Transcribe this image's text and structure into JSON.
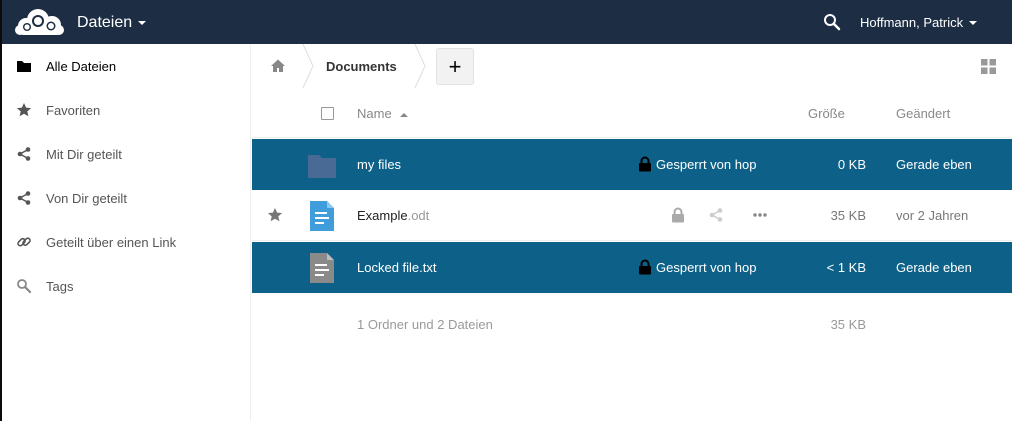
{
  "header": {
    "app_title": "Dateien",
    "user_name": "Hoffmann, Patrick",
    "colors": {
      "bar": "#1d2d44"
    }
  },
  "sidebar": {
    "items": [
      {
        "label": "Alle Dateien",
        "icon": "folder-icon",
        "active": true
      },
      {
        "label": "Favoriten",
        "icon": "star-icon",
        "active": false
      },
      {
        "label": "Mit Dir geteilt",
        "icon": "share-icon",
        "active": false
      },
      {
        "label": "Von Dir geteilt",
        "icon": "share-icon",
        "active": false
      },
      {
        "label": "Geteilt über einen Link",
        "icon": "link-icon",
        "active": false
      },
      {
        "label": "Tags",
        "icon": "tag-icon",
        "active": false
      }
    ]
  },
  "controls": {
    "breadcrumb": "Documents",
    "add_label": "+"
  },
  "table": {
    "columns": {
      "name": "Name",
      "size": "Größe",
      "modified": "Geändert"
    },
    "rows": [
      {
        "name": "my files",
        "ext": "",
        "lock_text": "Gesperrt von hop",
        "size": "0 KB",
        "modified": "Gerade eben",
        "type": "folder",
        "locked": true
      },
      {
        "name": "Example",
        "ext": ".odt",
        "lock_text": "",
        "size": "35 KB",
        "modified": "vor 2 Jahren",
        "type": "document",
        "locked": false
      },
      {
        "name": "Locked file.txt",
        "ext": "",
        "lock_text": "Gesperrt von hop",
        "size": "< 1 KB",
        "modified": "Gerade eben",
        "type": "text",
        "locked": true
      }
    ],
    "summary": {
      "text": "1 Ordner und 2 Dateien",
      "size": "35 KB"
    },
    "colors": {
      "locked_row": "#0d6189"
    }
  }
}
